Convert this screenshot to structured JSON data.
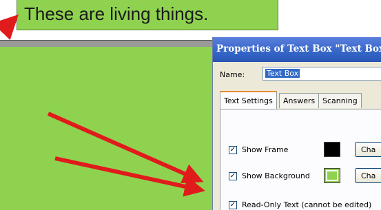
{
  "callout": {
    "text": "These are living things."
  },
  "dialog": {
    "title": "Properties of Text Box \"Text Box\"",
    "name_label": "Name:",
    "name_value": "Text Box",
    "tabs": [
      {
        "label": "Text Settings",
        "active": true
      },
      {
        "label": "Answers",
        "active": false
      },
      {
        "label": "Scanning",
        "active": false
      }
    ],
    "show_frame": {
      "label": "Show Frame",
      "checked": true,
      "mark": "✓",
      "color": "#000000",
      "button_label": "Cha"
    },
    "show_background": {
      "label": "Show Background",
      "checked": true,
      "mark": "✓",
      "color": "#8fd24f",
      "button_label": "Cha"
    },
    "read_only": {
      "label": "Read-Only Text (cannot be edited)",
      "checked": true,
      "mark": "✓"
    }
  },
  "colors": {
    "textbox_background": "#8fd24f",
    "arrow": "#e01b1b",
    "titlebar": "#3566c8"
  }
}
